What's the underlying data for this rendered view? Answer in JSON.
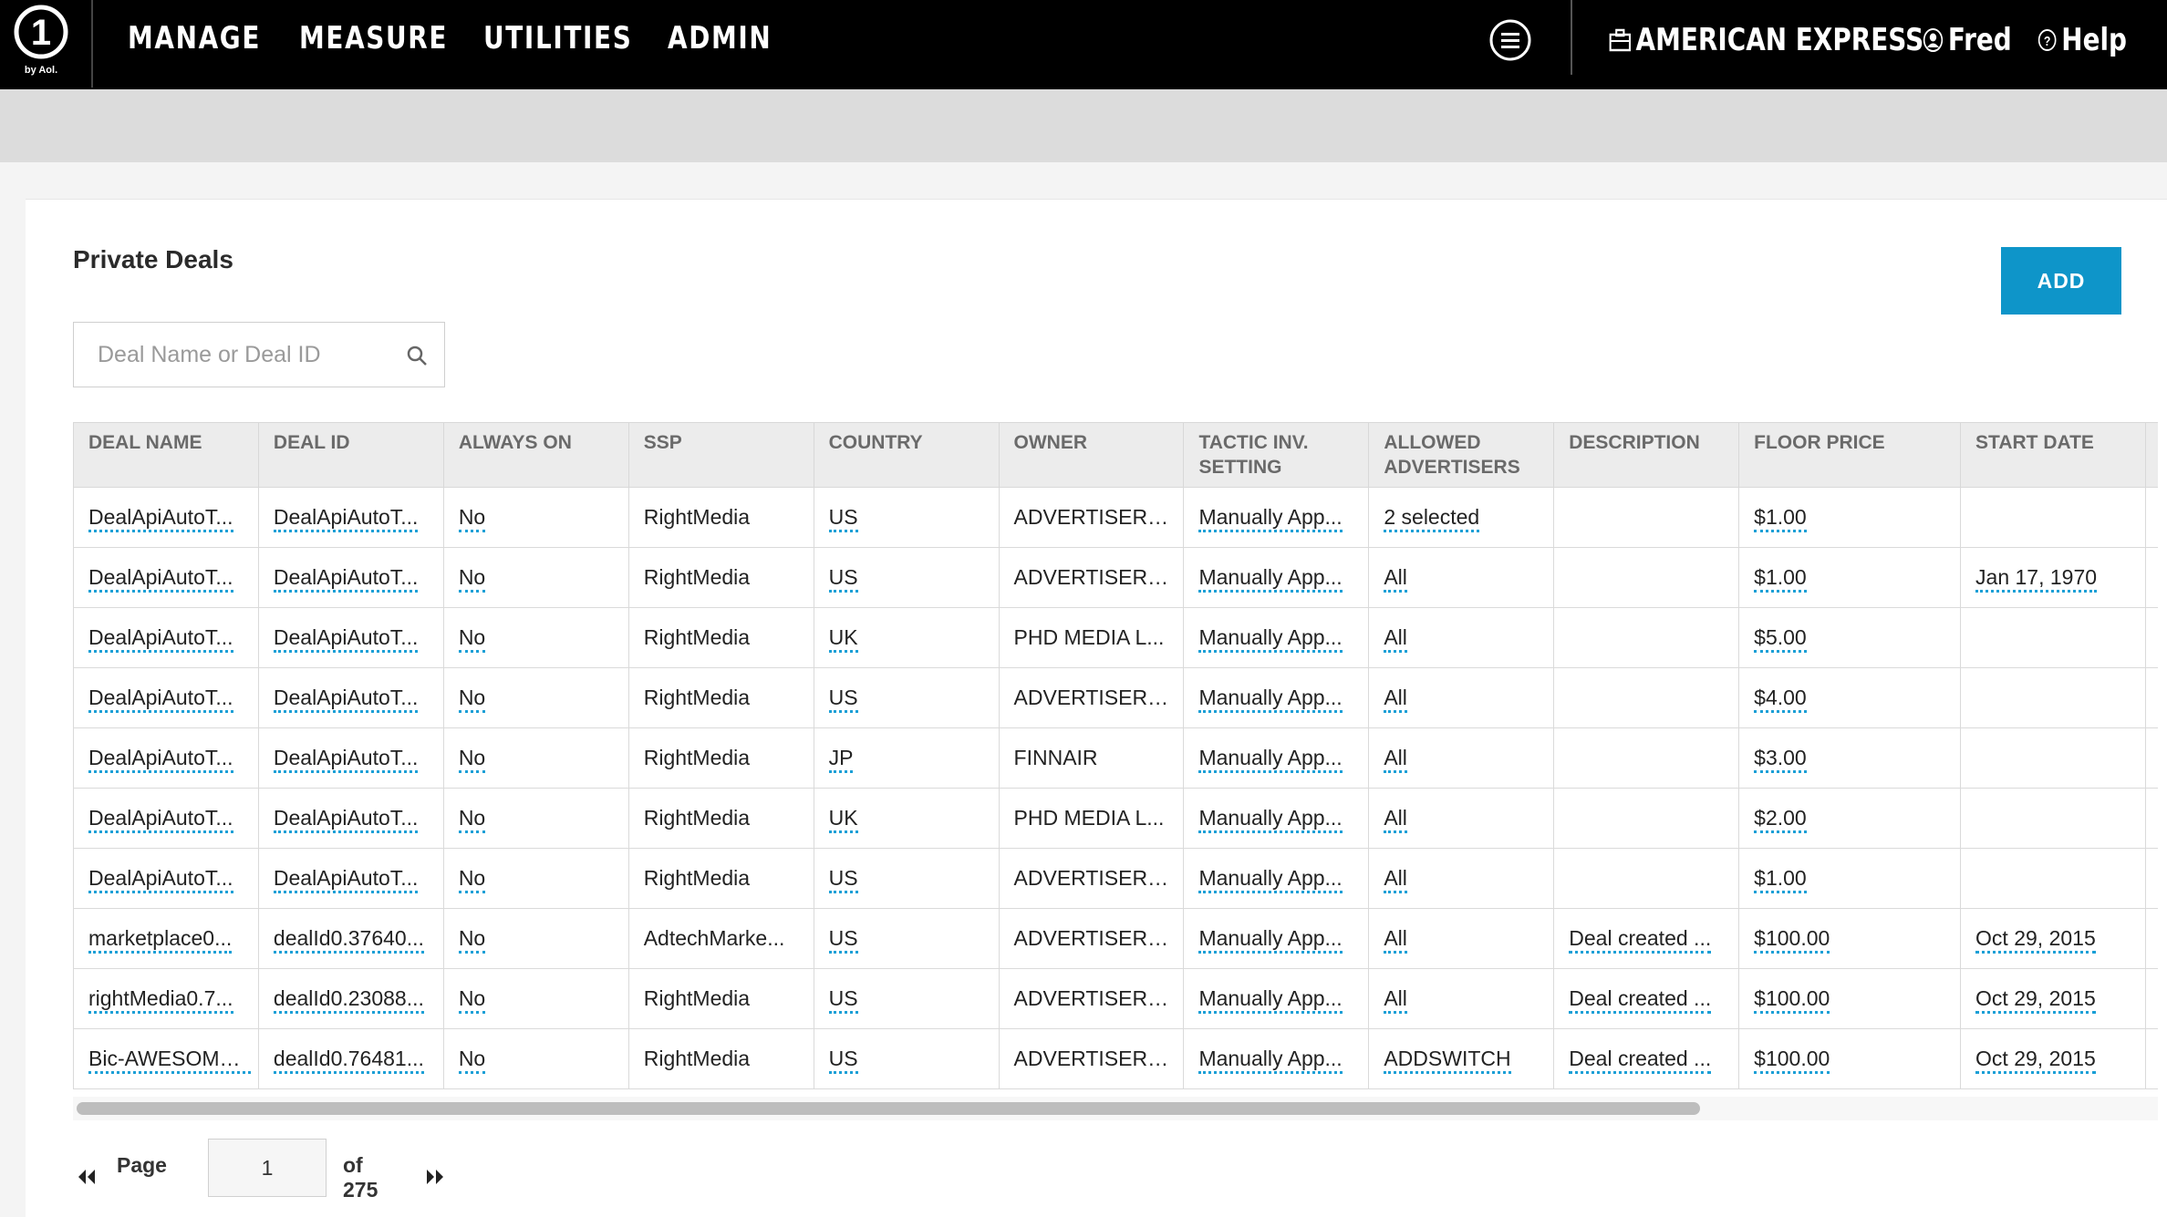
{
  "nav": {
    "items": [
      {
        "label": "MANAGE"
      },
      {
        "label": "MEASURE"
      },
      {
        "label": "UTILITIES"
      },
      {
        "label": "ADMIN"
      }
    ],
    "account": "AMERICAN EXPRESS",
    "user": "Fred",
    "help": "Help",
    "logo_text": "by Aol."
  },
  "page": {
    "title": "Private Deals",
    "add_label": "ADD",
    "search_placeholder": "Deal Name or Deal ID"
  },
  "table": {
    "columns": [
      "DEAL NAME",
      "DEAL ID",
      "ALWAYS ON",
      "SSP",
      "COUNTRY",
      "OWNER",
      "TACTIC INV. SETTING",
      "ALLOWED ADVERTISERS",
      "DESCRIPTION",
      "FLOOR PRICE",
      "START DATE"
    ],
    "rows": [
      {
        "deal_name": "DealApiAutoT...",
        "deal_id": "DealApiAutoT...",
        "always_on": "No",
        "ssp": "RightMedia",
        "country": "US",
        "owner": "ADVERTISER ...",
        "tactic": "Manually App...",
        "advertisers": "2 selected",
        "description": "",
        "floor_price": "$1.00",
        "start_date": ""
      },
      {
        "deal_name": "DealApiAutoT...",
        "deal_id": "DealApiAutoT...",
        "always_on": "No",
        "ssp": "RightMedia",
        "country": "US",
        "owner": "ADVERTISER ...",
        "tactic": "Manually App...",
        "advertisers": "All",
        "description": "",
        "floor_price": "$1.00",
        "start_date": "Jan 17, 1970"
      },
      {
        "deal_name": "DealApiAutoT...",
        "deal_id": "DealApiAutoT...",
        "always_on": "No",
        "ssp": "RightMedia",
        "country": "UK",
        "owner": "PHD MEDIA L...",
        "tactic": "Manually App...",
        "advertisers": "All",
        "description": "",
        "floor_price": "$5.00",
        "start_date": ""
      },
      {
        "deal_name": "DealApiAutoT...",
        "deal_id": "DealApiAutoT...",
        "always_on": "No",
        "ssp": "RightMedia",
        "country": "US",
        "owner": "ADVERTISER ...",
        "tactic": "Manually App...",
        "advertisers": "All",
        "description": "",
        "floor_price": "$4.00",
        "start_date": ""
      },
      {
        "deal_name": "DealApiAutoT...",
        "deal_id": "DealApiAutoT...",
        "always_on": "No",
        "ssp": "RightMedia",
        "country": "JP",
        "owner": "FINNAIR",
        "tactic": "Manually App...",
        "advertisers": "All",
        "description": "",
        "floor_price": "$3.00",
        "start_date": ""
      },
      {
        "deal_name": "DealApiAutoT...",
        "deal_id": "DealApiAutoT...",
        "always_on": "No",
        "ssp": "RightMedia",
        "country": "UK",
        "owner": "PHD MEDIA L...",
        "tactic": "Manually App...",
        "advertisers": "All",
        "description": "",
        "floor_price": "$2.00",
        "start_date": ""
      },
      {
        "deal_name": "DealApiAutoT...",
        "deal_id": "DealApiAutoT...",
        "always_on": "No",
        "ssp": "RightMedia",
        "country": "US",
        "owner": "ADVERTISER ...",
        "tactic": "Manually App...",
        "advertisers": "All",
        "description": "",
        "floor_price": "$1.00",
        "start_date": ""
      },
      {
        "deal_name": "marketplace0...",
        "deal_id": "dealId0.37640...",
        "always_on": "No",
        "ssp": "AdtechMarke...",
        "country": "US",
        "owner": "ADVERTISER ...",
        "tactic": "Manually App...",
        "advertisers": "All",
        "description": "Deal created ...",
        "floor_price": "$100.00",
        "start_date": "Oct 29, 2015"
      },
      {
        "deal_name": "rightMedia0.7...",
        "deal_id": "dealId0.23088...",
        "always_on": "No",
        "ssp": "RightMedia",
        "country": "US",
        "owner": "ADVERTISER ...",
        "tactic": "Manually App...",
        "advertisers": "All",
        "description": "Deal created ...",
        "floor_price": "$100.00",
        "start_date": "Oct 29, 2015"
      },
      {
        "deal_name": "Bic-AWESOME...",
        "deal_id": "dealId0.76481...",
        "always_on": "No",
        "ssp": "RightMedia",
        "country": "US",
        "owner": "ADVERTISER ...",
        "tactic": "Manually App...",
        "advertisers": "ADDSWITCH",
        "description": "Deal created ...",
        "floor_price": "$100.00",
        "start_date": "Oct 29, 2015"
      }
    ]
  },
  "pager": {
    "label": "Page",
    "current": "1",
    "of": "of 275"
  },
  "colors": {
    "topbar": "#000000",
    "accent": "#0e95c9",
    "link_underline": "#1a9fd6"
  }
}
